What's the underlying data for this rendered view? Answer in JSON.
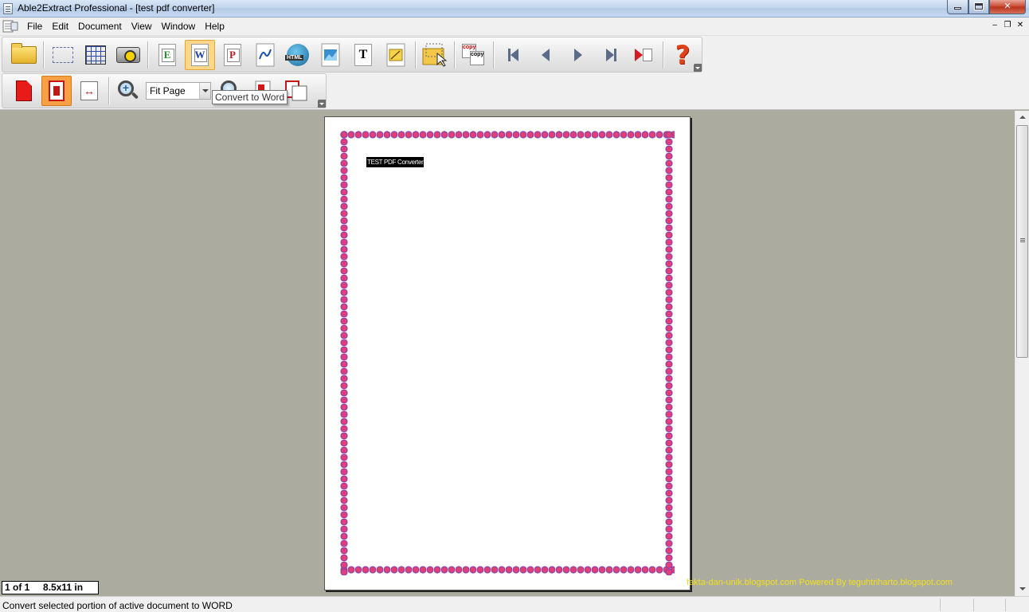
{
  "window": {
    "title": "Able2Extract Professional - [test pdf converter]",
    "close_symbol": "✕"
  },
  "menu": {
    "items": [
      "File",
      "Edit",
      "Document",
      "View",
      "Window",
      "Help"
    ],
    "mdi_minimize": "–",
    "mdi_restore": "❐",
    "mdi_close": "✕"
  },
  "toolbar1": {
    "excel_letter": "E",
    "word_letter": "W",
    "ppt_letter": "P",
    "text_letter": "T",
    "copy_top": "copy",
    "copy_bottom": "copy",
    "help_glyph": "?"
  },
  "toolbar2": {
    "zoom_value": "Fit Page",
    "zoom_in_glyph": "+"
  },
  "tooltip": "Convert to Word",
  "document": {
    "heading": "TEST PDF Converter"
  },
  "page_info": {
    "page": "1 of 1",
    "size": "8.5x11 in"
  },
  "watermark": "fakta-dan-unik.blogspot.com Powered By teguhtriharto.blogspot.com",
  "status": {
    "message": "Convert selected portion of active document to WORD"
  },
  "colors": {
    "titlebar": "#c3d6ee",
    "workspace": "#ababa0",
    "active_button": "#fbd78a",
    "watermark": "#f0e01c"
  }
}
